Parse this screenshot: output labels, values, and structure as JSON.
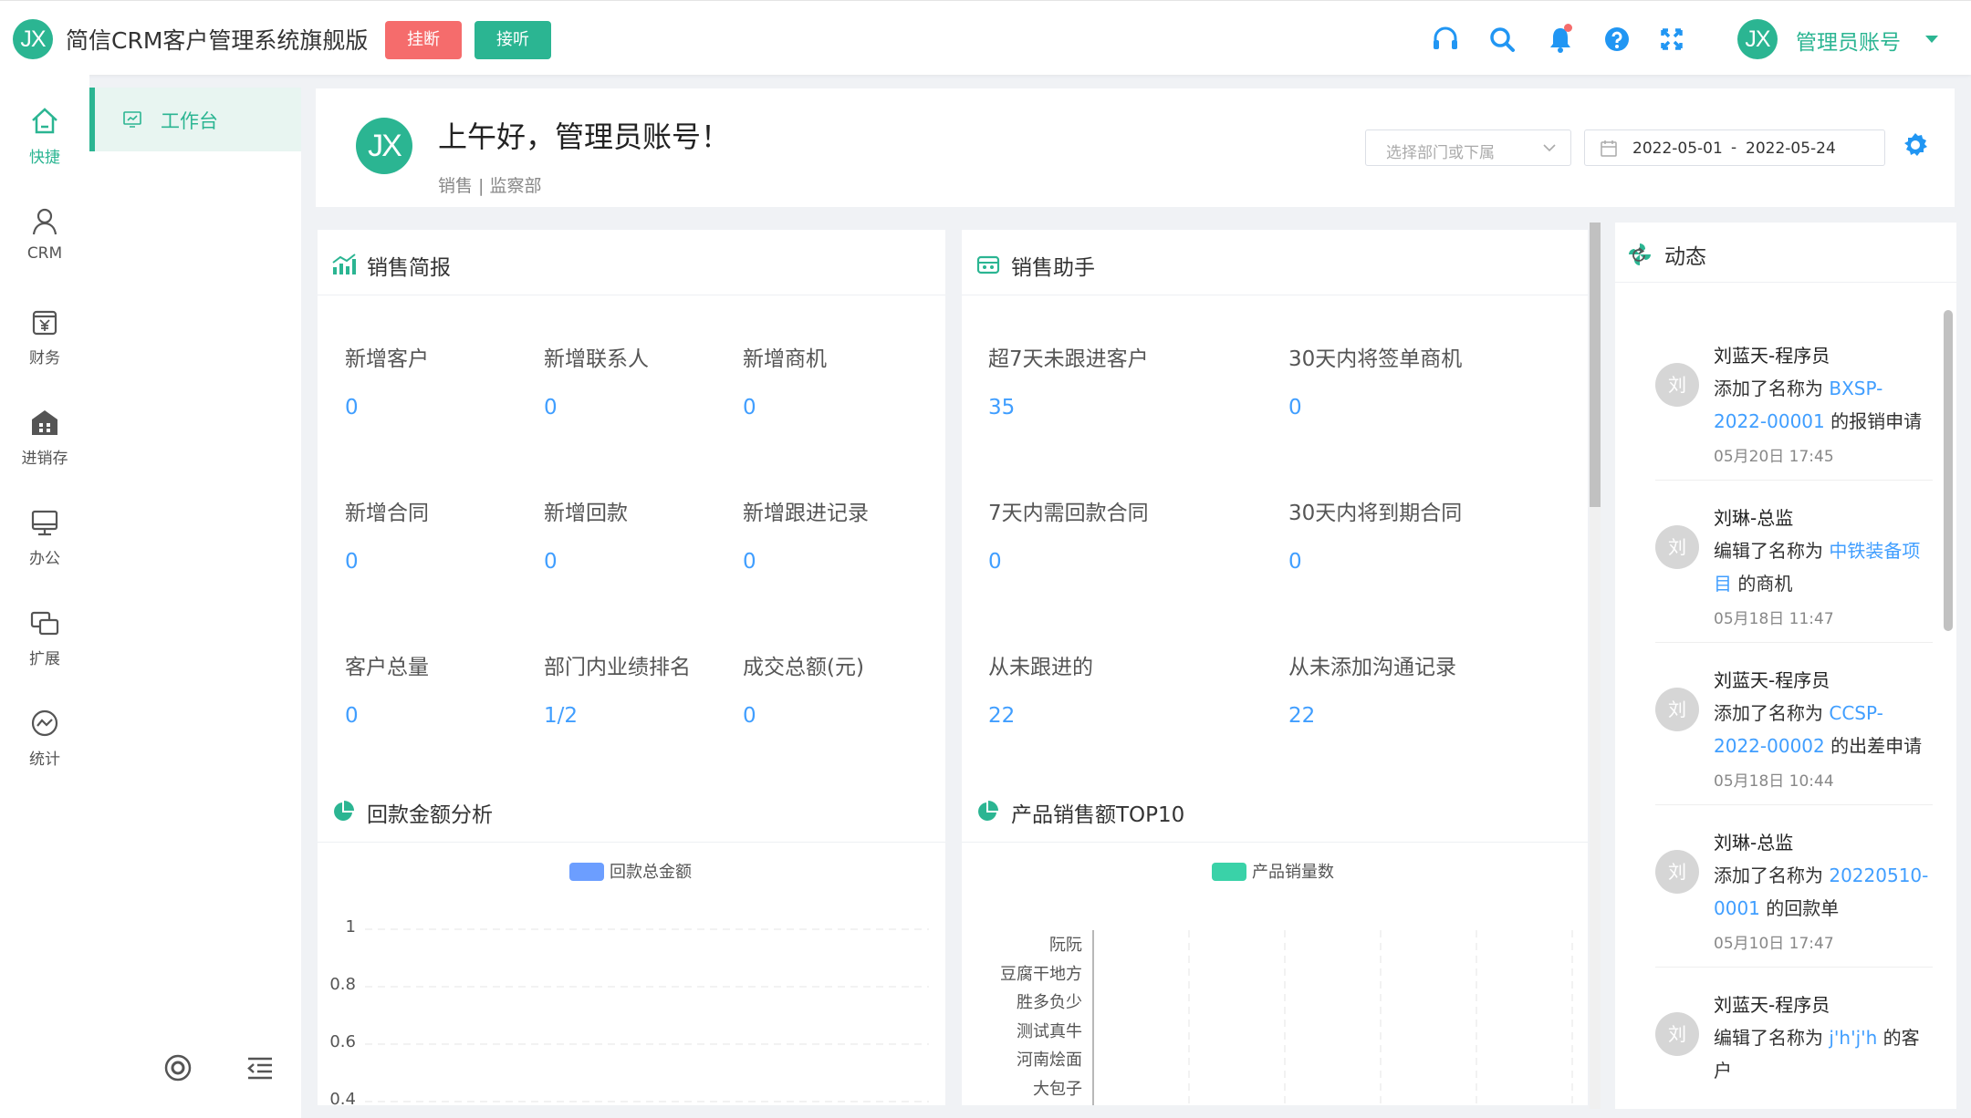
{
  "app": {
    "logo_text": "JX",
    "title": "简信CRM客户管理系统旗舰版",
    "hangup_label": "挂断",
    "answer_label": "接听",
    "user_avatar_text": "JX",
    "user_name": "管理员账号"
  },
  "nav": {
    "items": [
      {
        "label": "快捷",
        "icon": "home-icon",
        "active": true
      },
      {
        "label": "CRM",
        "icon": "user-icon"
      },
      {
        "label": "财务",
        "icon": "yen-box-icon"
      },
      {
        "label": "进销存",
        "icon": "warehouse-icon"
      },
      {
        "label": "办公",
        "icon": "monitor-icon"
      },
      {
        "label": "扩展",
        "icon": "extend-icon"
      },
      {
        "label": "统计",
        "icon": "chart-circle-icon"
      }
    ]
  },
  "subnav": {
    "items": [
      {
        "label": "工作台",
        "icon": "dashboard-icon",
        "active": true
      }
    ]
  },
  "header": {
    "avatar_text": "JX",
    "greeting": "上午好，管理员账号！",
    "dept": "销售 | 监察部",
    "dept_placeholder": "选择部门或下属",
    "date_start": "2022-05-01",
    "date_sep": "-",
    "date_end": "2022-05-24"
  },
  "sales_brief": {
    "title": "销售简报",
    "stats": [
      {
        "label": "新增客户",
        "value": "0"
      },
      {
        "label": "新增联系人",
        "value": "0"
      },
      {
        "label": "新增商机",
        "value": "0"
      },
      {
        "label": "新增合同",
        "value": "0"
      },
      {
        "label": "新增回款",
        "value": "0"
      },
      {
        "label": "新增跟进记录",
        "value": "0"
      },
      {
        "label": "客户总量",
        "value": "0"
      },
      {
        "label": "部门内业绩排名",
        "value": "1/2"
      },
      {
        "label": "成交总额(元)",
        "value": "0"
      }
    ]
  },
  "sales_assistant": {
    "title": "销售助手",
    "stats": [
      {
        "label": "超7天未跟进客户",
        "value": "35"
      },
      {
        "label": "30天内将签单商机",
        "value": "0"
      },
      {
        "label": "7天内需回款合同",
        "value": "0"
      },
      {
        "label": "30天内将到期合同",
        "value": "0"
      },
      {
        "label": "从未跟进的",
        "value": "22"
      },
      {
        "label": "从未添加沟通记录",
        "value": "22"
      }
    ]
  },
  "payment_analysis": {
    "title": "回款金额分析",
    "legend": "回款总金额",
    "color": "#6c9eff",
    "yticks": [
      "1",
      "0.8",
      "0.6",
      "0.4"
    ]
  },
  "product_top10": {
    "title": "产品销售额TOP10",
    "legend": "产品销量数",
    "color": "#3ad2a8",
    "categories": [
      "阮阮",
      "豆腐干地方",
      "胜多负少",
      "测试真牛",
      "河南烩面",
      "大包子"
    ]
  },
  "chart_data": [
    {
      "type": "line",
      "title": "回款金额分析",
      "series": [
        {
          "name": "回款总金额",
          "values": []
        }
      ],
      "ylim": [
        0,
        1
      ],
      "yticks": [
        1,
        0.8,
        0.6,
        0.4
      ]
    },
    {
      "type": "bar",
      "title": "产品销售额TOP10",
      "categories": [
        "阮阮",
        "豆腐干地方",
        "胜多负少",
        "测试真牛",
        "河南烩面",
        "大包子"
      ],
      "series": [
        {
          "name": "产品销量数",
          "values": [
            0,
            0,
            0,
            0,
            0,
            0
          ]
        }
      ]
    }
  ],
  "activity": {
    "title": "动态",
    "items": [
      {
        "avatar": "刘",
        "name": "刘蓝天-程序员",
        "pre": "添加了名称为 ",
        "link": "BXSP-2022-00001",
        "post": " 的报销申请",
        "time": "05月20日 17:45"
      },
      {
        "avatar": "刘",
        "name": "刘琳-总监",
        "pre": "编辑了名称为 ",
        "link": "中铁装备项目",
        "post": " 的商机",
        "time": "05月18日 11:47"
      },
      {
        "avatar": "刘",
        "name": "刘蓝天-程序员",
        "pre": "添加了名称为 ",
        "link": "CCSP-2022-00002",
        "post": " 的出差申请",
        "time": "05月18日 10:44"
      },
      {
        "avatar": "刘",
        "name": "刘琳-总监",
        "pre": "添加了名称为 ",
        "link": "20220510-0001",
        "post": " 的回款单",
        "time": "05月10日 17:47"
      },
      {
        "avatar": "刘",
        "name": "刘蓝天-程序员",
        "pre": "编辑了名称为 ",
        "link": "j'h'j'h",
        "post": " 的客户",
        "time": ""
      }
    ]
  }
}
